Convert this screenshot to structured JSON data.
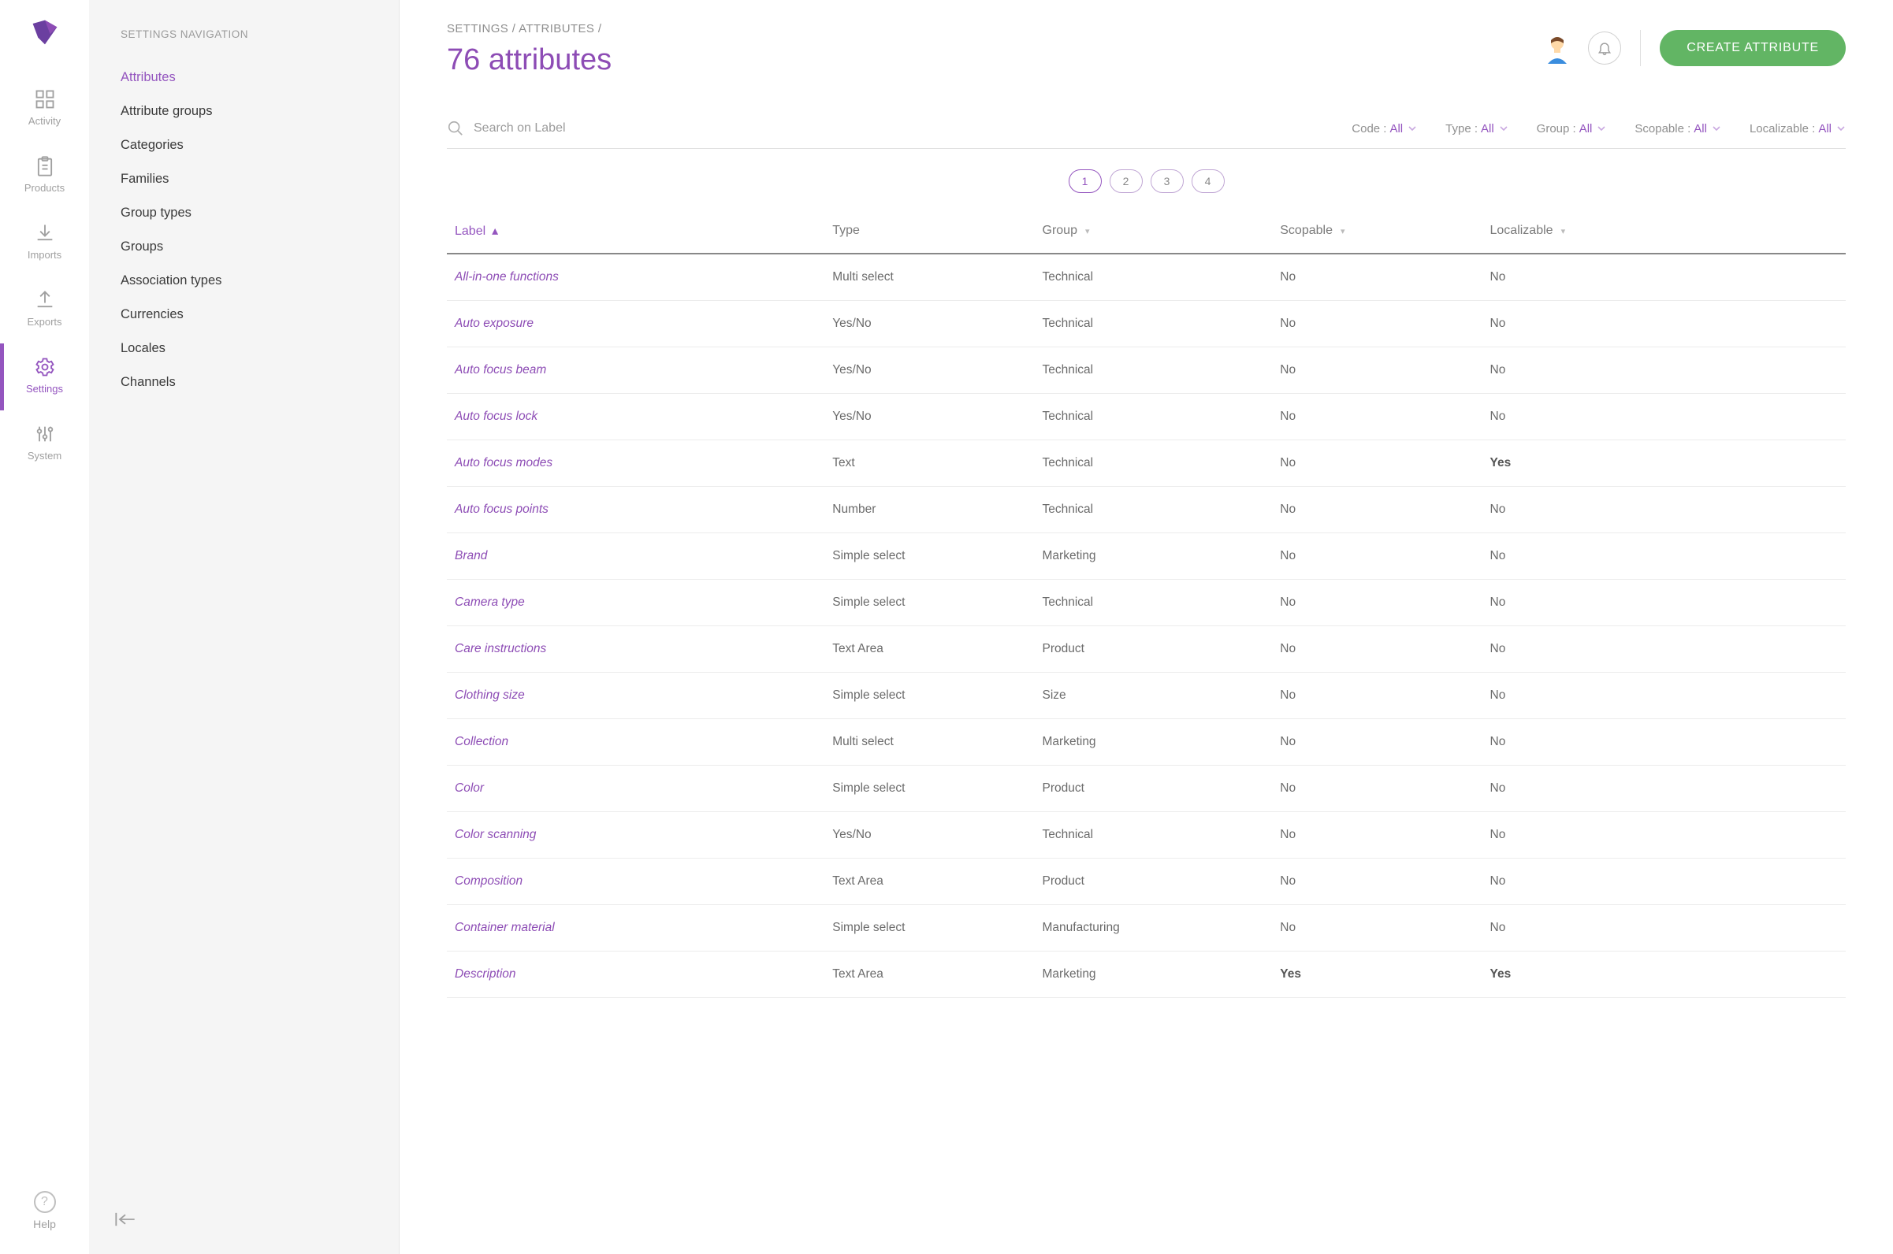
{
  "rail": {
    "items": [
      {
        "label": "Activity"
      },
      {
        "label": "Products"
      },
      {
        "label": "Imports"
      },
      {
        "label": "Exports"
      },
      {
        "label": "Settings"
      },
      {
        "label": "System"
      }
    ],
    "help_label": "Help"
  },
  "sidebar": {
    "title": "SETTINGS NAVIGATION",
    "items": [
      {
        "label": "Attributes"
      },
      {
        "label": "Attribute groups"
      },
      {
        "label": "Categories"
      },
      {
        "label": "Families"
      },
      {
        "label": "Group types"
      },
      {
        "label": "Groups"
      },
      {
        "label": "Association types"
      },
      {
        "label": "Currencies"
      },
      {
        "label": "Locales"
      },
      {
        "label": "Channels"
      }
    ]
  },
  "header": {
    "breadcrumb": "SETTINGS / ATTRIBUTES /",
    "title": "76 attributes",
    "create_label": "CREATE ATTRIBUTE"
  },
  "search": {
    "placeholder": "Search on Label"
  },
  "filters": [
    {
      "name": "Code",
      "value": "All"
    },
    {
      "name": "Type",
      "value": "All"
    },
    {
      "name": "Group",
      "value": "All"
    },
    {
      "name": "Scopable",
      "value": "All"
    },
    {
      "name": "Localizable",
      "value": "All"
    }
  ],
  "pagination": {
    "pages": [
      "1",
      "2",
      "3",
      "4"
    ],
    "active": "1"
  },
  "columns": [
    {
      "label": "Label",
      "sorted": true
    },
    {
      "label": "Type"
    },
    {
      "label": "Group",
      "caret": true
    },
    {
      "label": "Scopable",
      "caret": true
    },
    {
      "label": "Localizable",
      "caret": true
    }
  ],
  "rows": [
    {
      "label": "All-in-one functions",
      "type": "Multi select",
      "group": "Technical",
      "scopable": "No",
      "localizable": "No"
    },
    {
      "label": "Auto exposure",
      "type": "Yes/No",
      "group": "Technical",
      "scopable": "No",
      "localizable": "No"
    },
    {
      "label": "Auto focus beam",
      "type": "Yes/No",
      "group": "Technical",
      "scopable": "No",
      "localizable": "No"
    },
    {
      "label": "Auto focus lock",
      "type": "Yes/No",
      "group": "Technical",
      "scopable": "No",
      "localizable": "No"
    },
    {
      "label": "Auto focus modes",
      "type": "Text",
      "group": "Technical",
      "scopable": "No",
      "localizable": "Yes",
      "loc_bold": true
    },
    {
      "label": "Auto focus points",
      "type": "Number",
      "group": "Technical",
      "scopable": "No",
      "localizable": "No"
    },
    {
      "label": "Brand",
      "type": "Simple select",
      "group": "Marketing",
      "scopable": "No",
      "localizable": "No"
    },
    {
      "label": "Camera type",
      "type": "Simple select",
      "group": "Technical",
      "scopable": "No",
      "localizable": "No"
    },
    {
      "label": "Care instructions",
      "type": "Text Area",
      "group": "Product",
      "scopable": "No",
      "localizable": "No"
    },
    {
      "label": "Clothing size",
      "type": "Simple select",
      "group": "Size",
      "scopable": "No",
      "localizable": "No"
    },
    {
      "label": "Collection",
      "type": "Multi select",
      "group": "Marketing",
      "scopable": "No",
      "localizable": "No"
    },
    {
      "label": "Color",
      "type": "Simple select",
      "group": "Product",
      "scopable": "No",
      "localizable": "No"
    },
    {
      "label": "Color scanning",
      "type": "Yes/No",
      "group": "Technical",
      "scopable": "No",
      "localizable": "No"
    },
    {
      "label": "Composition",
      "type": "Text Area",
      "group": "Product",
      "scopable": "No",
      "localizable": "No"
    },
    {
      "label": "Container material",
      "type": "Simple select",
      "group": "Manufacturing",
      "scopable": "No",
      "localizable": "No"
    },
    {
      "label": "Description",
      "type": "Text Area",
      "group": "Marketing",
      "scopable": "Yes",
      "scop_bold": true,
      "localizable": "Yes",
      "loc_bold": true
    }
  ]
}
